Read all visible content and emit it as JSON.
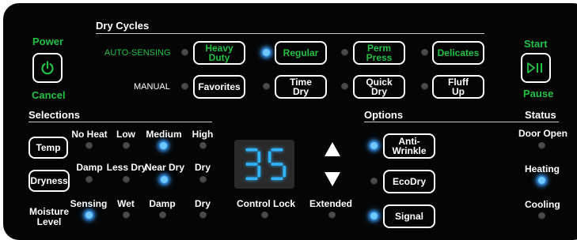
{
  "dry_cycles": {
    "title": "Dry Cycles",
    "auto_label": "AUTO-SENSING",
    "manual_label": "MANUAL",
    "auto": [
      {
        "line1": "Heavy",
        "line2": "Duty",
        "led_on": false
      },
      {
        "line1": "Regular",
        "line2": "",
        "led_on": true
      },
      {
        "line1": "Perm",
        "line2": "Press",
        "led_on": false
      },
      {
        "line1": "Delicates",
        "line2": "",
        "led_on": false
      }
    ],
    "manual": [
      {
        "line1": "Favorites",
        "line2": "",
        "led_on": false
      },
      {
        "line1": "Time",
        "line2": "Dry",
        "led_on": false
      },
      {
        "line1": "Quick",
        "line2": "Dry",
        "led_on": false
      },
      {
        "line1": "Fluff",
        "line2": "Up",
        "led_on": false
      }
    ]
  },
  "power": {
    "label": "Power",
    "sub_label": "Cancel",
    "icon": "power-icon"
  },
  "start": {
    "label": "Start",
    "sub_label": "Pause",
    "icon": "play-pause-icon"
  },
  "selections": {
    "title": "Selections",
    "temp": {
      "button": "Temp",
      "options": [
        {
          "label": "No Heat",
          "on": false
        },
        {
          "label": "Low",
          "on": false
        },
        {
          "label": "Medium",
          "on": true
        },
        {
          "label": "High",
          "on": false
        }
      ]
    },
    "dryness": {
      "button": "Dryness",
      "options": [
        {
          "label": "Damp",
          "on": false
        },
        {
          "label": "Less Dry",
          "on": false
        },
        {
          "label": "Near Dry",
          "on": true
        },
        {
          "label": "Dry",
          "on": false
        }
      ]
    },
    "moisture": {
      "label_line1": "Moisture",
      "label_line2": "Level",
      "options": [
        {
          "label": "Sensing",
          "on": true
        },
        {
          "label": "Wet",
          "on": false
        },
        {
          "label": "Damp",
          "on": false
        },
        {
          "label": "Dry",
          "on": false
        }
      ]
    }
  },
  "display": {
    "value": "35",
    "color": "#2fb4ff"
  },
  "control_lock": {
    "label": "Control Lock",
    "on": false
  },
  "extended": {
    "label": "Extended",
    "on": false
  },
  "arrows": {
    "up": "up-arrow-icon",
    "down": "down-arrow-icon"
  },
  "options": {
    "title": "Options",
    "items": [
      {
        "line1": "Anti-",
        "line2": "Wrinkle",
        "on": true
      },
      {
        "line1": "EcoDry",
        "line2": "",
        "on": false
      },
      {
        "line1": "Signal",
        "line2": "",
        "on": true
      }
    ]
  },
  "status": {
    "title": "Status",
    "items": [
      {
        "label": "Door Open",
        "on": false
      },
      {
        "label": "Heating",
        "on": true
      },
      {
        "label": "Cooling",
        "on": false
      }
    ]
  },
  "colors": {
    "accent_green": "#22c043",
    "led_blue": "#3aa0ff",
    "panel": "#050505"
  }
}
